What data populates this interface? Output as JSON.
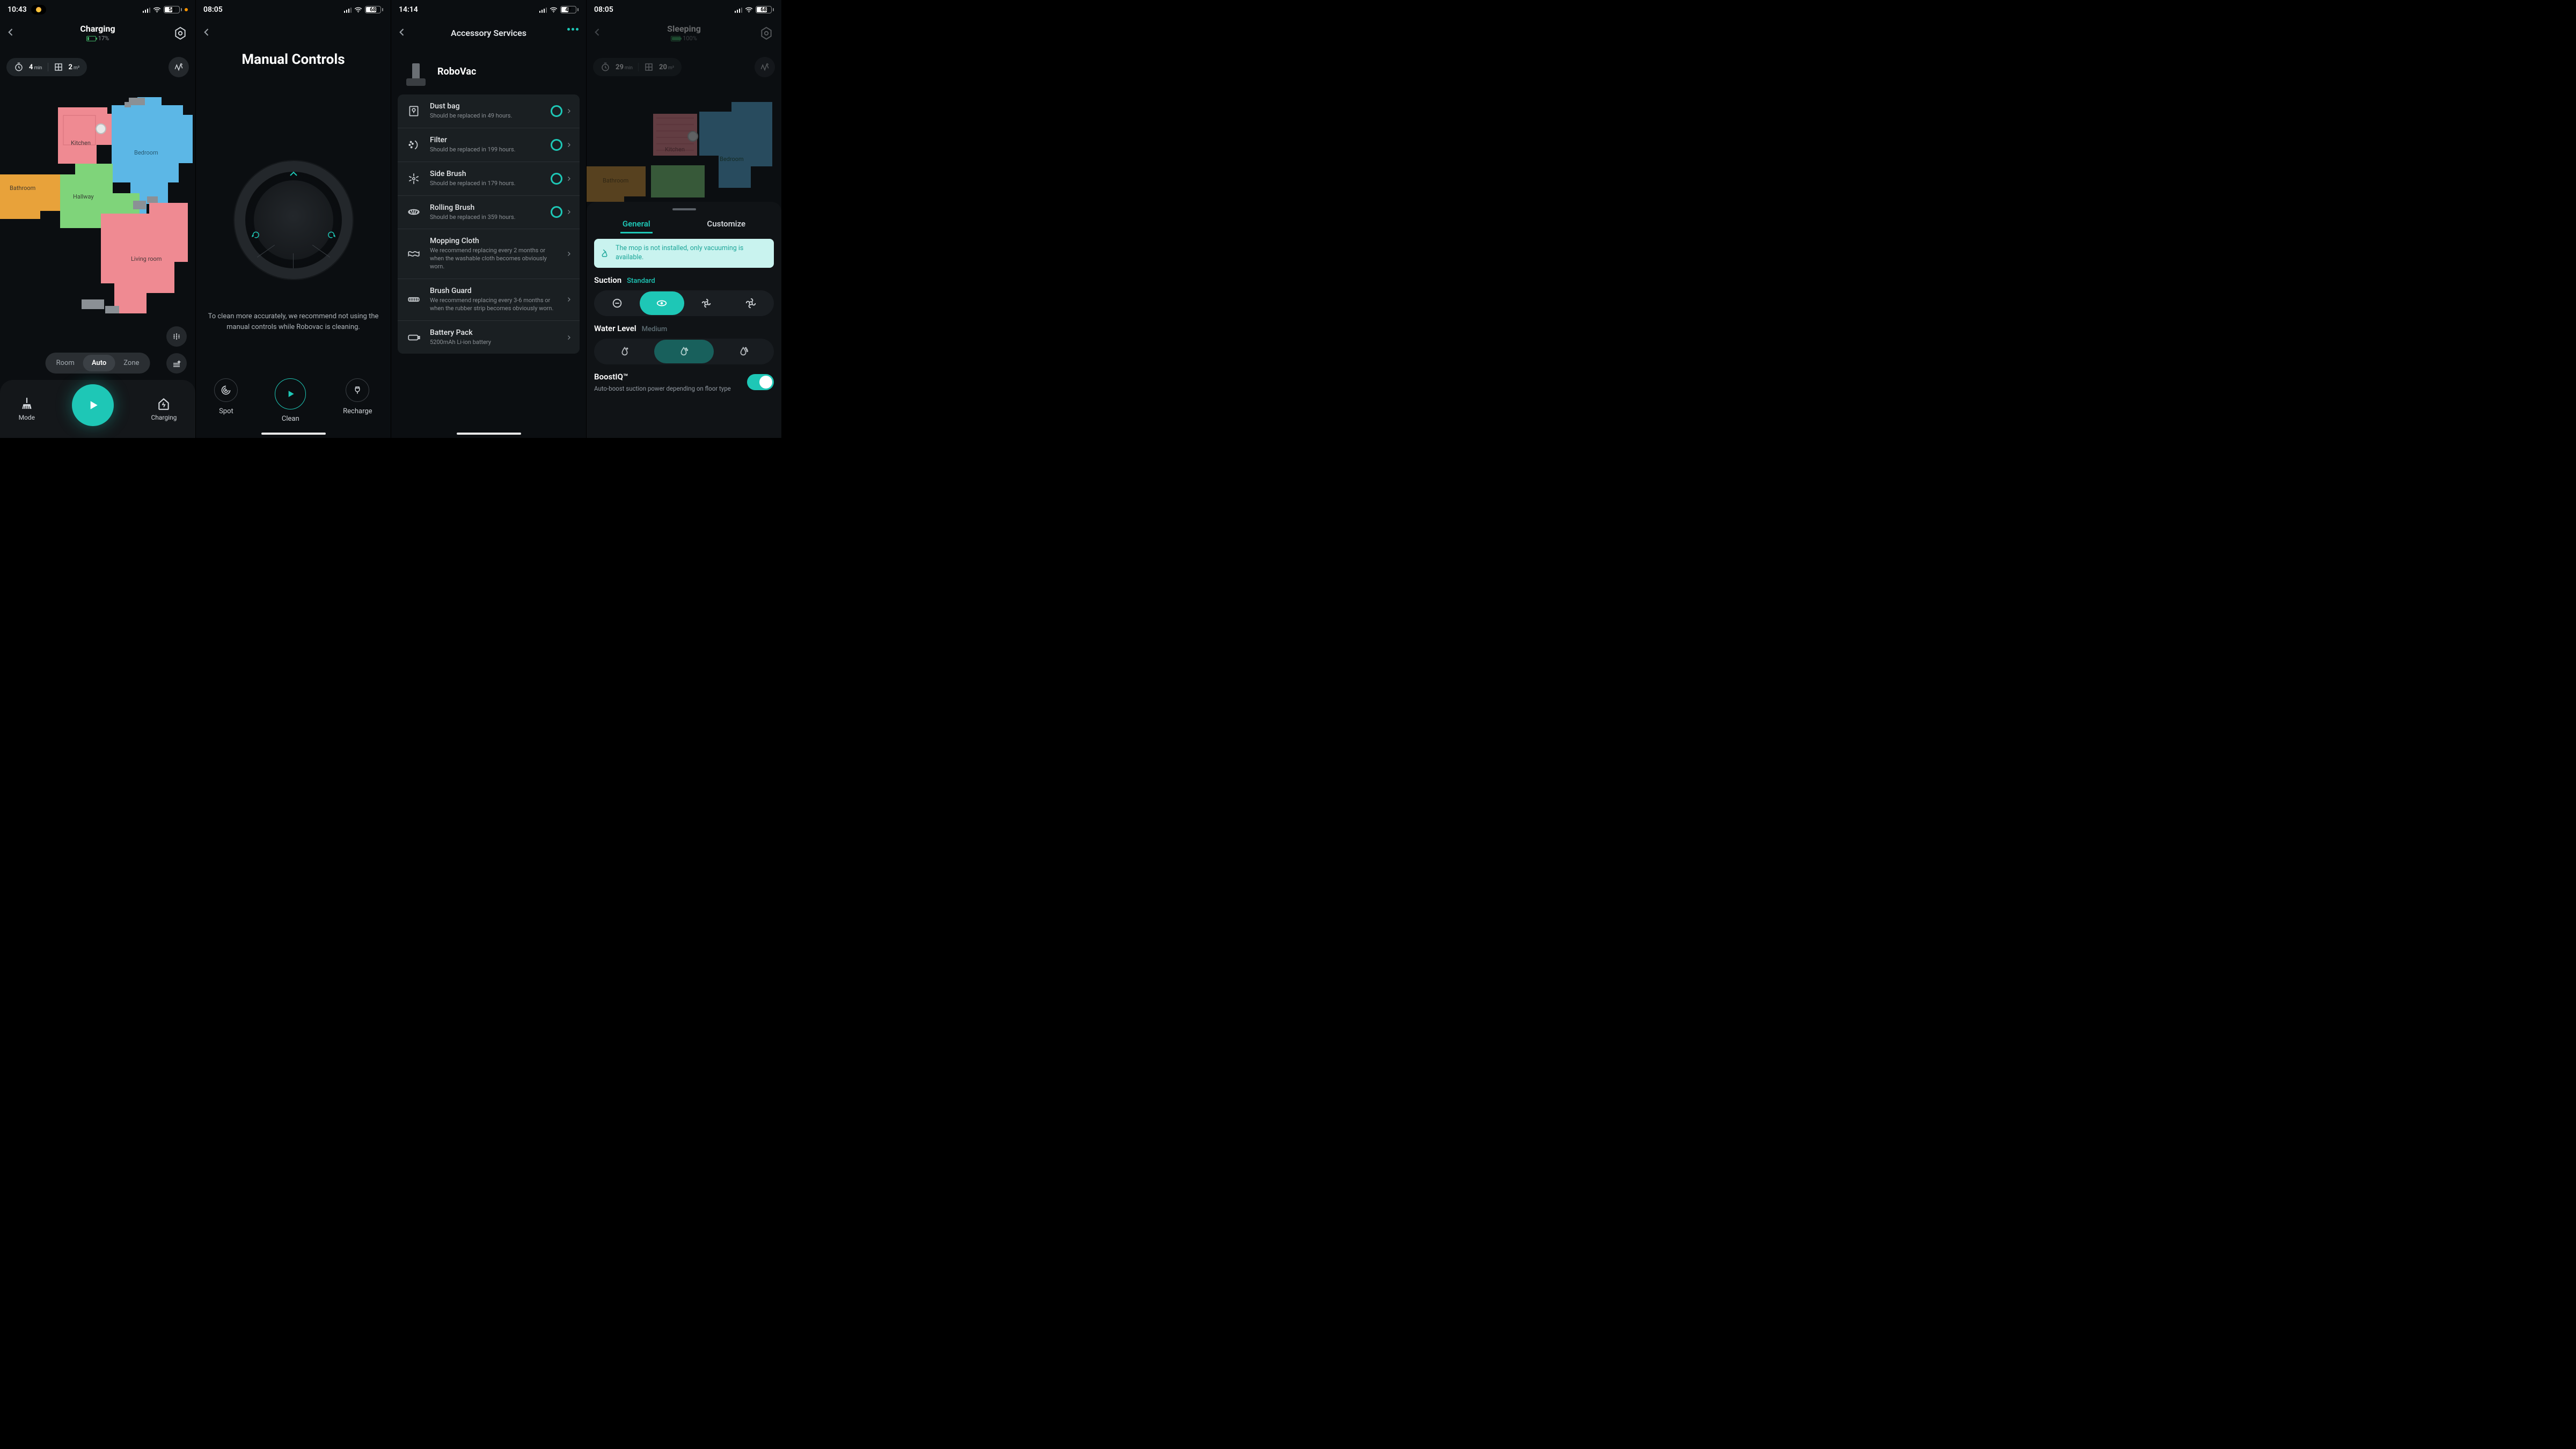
{
  "p1": {
    "status_time": "10:43",
    "battery_pct": "50",
    "header": {
      "title": "Charging",
      "battery_text": "17%",
      "battery_fill_pct": 17
    },
    "stats": {
      "time_value": "4",
      "time_unit": "min",
      "area_value": "2",
      "area_unit": "m²"
    },
    "rooms": {
      "kitchen": "Kitchen",
      "bedroom": "Bedroom",
      "bathroom": "Bathroom",
      "hallway": "Hallway",
      "living": "Living room"
    },
    "modes": {
      "room": "Room",
      "auto": "Auto",
      "zone": "Zone"
    },
    "bottom": {
      "mode": "Mode",
      "charging": "Charging"
    }
  },
  "p2": {
    "status_time": "08:05",
    "battery_pct": "68",
    "title": "Manual Controls",
    "hint": "To clean more accurately, we recommend not using the manual controls while Robovac is cleaning.",
    "actions": {
      "spot": "Spot",
      "clean": "Clean",
      "recharge": "Recharge"
    }
  },
  "p3": {
    "status_time": "14:14",
    "battery_pct": "47",
    "title": "Accessory Services",
    "device_name": "RoboVac",
    "items": [
      {
        "title": "Dust bag",
        "sub": "Should be replaced in 49 hours.",
        "ring": true
      },
      {
        "title": "Filter",
        "sub": "Should be replaced in 199 hours.",
        "ring": true
      },
      {
        "title": "Side Brush",
        "sub": "Should be replaced in 179 hours.",
        "ring": true
      },
      {
        "title": "Rolling Brush",
        "sub": "Should be replaced in 359 hours.",
        "ring": true
      },
      {
        "title": "Mopping Cloth",
        "sub": "We recommend replacing every 2 months or when the washable cloth becomes obviously worn.",
        "ring": false
      },
      {
        "title": "Brush Guard",
        "sub": "We recommend replacing every 3-6 months or when the rubber strip becomes obviously worn.",
        "ring": false
      },
      {
        "title": "Battery Pack",
        "sub": "5200mAh Li-ion battery",
        "ring": false
      }
    ]
  },
  "p4": {
    "status_time": "08:05",
    "battery_pct": "68",
    "header": {
      "title": "Sleeping",
      "battery_text": "100%"
    },
    "stats": {
      "time_value": "29",
      "time_unit": "min",
      "area_value": "20",
      "area_unit": "m²"
    },
    "rooms": {
      "kitchen": "Kitchen",
      "bedroom": "Bedroom",
      "bathroom": "Bathroom"
    },
    "tabs": {
      "general": "General",
      "customize": "Customize"
    },
    "banner": "The mop is not installed, only vacuuming is available.",
    "suction": {
      "label": "Suction",
      "value": "Standard"
    },
    "water": {
      "label": "Water Level",
      "value": "Medium"
    },
    "boost": {
      "label": "BoostIQ™",
      "desc": "Auto-boost suction power depending on floor type"
    }
  }
}
